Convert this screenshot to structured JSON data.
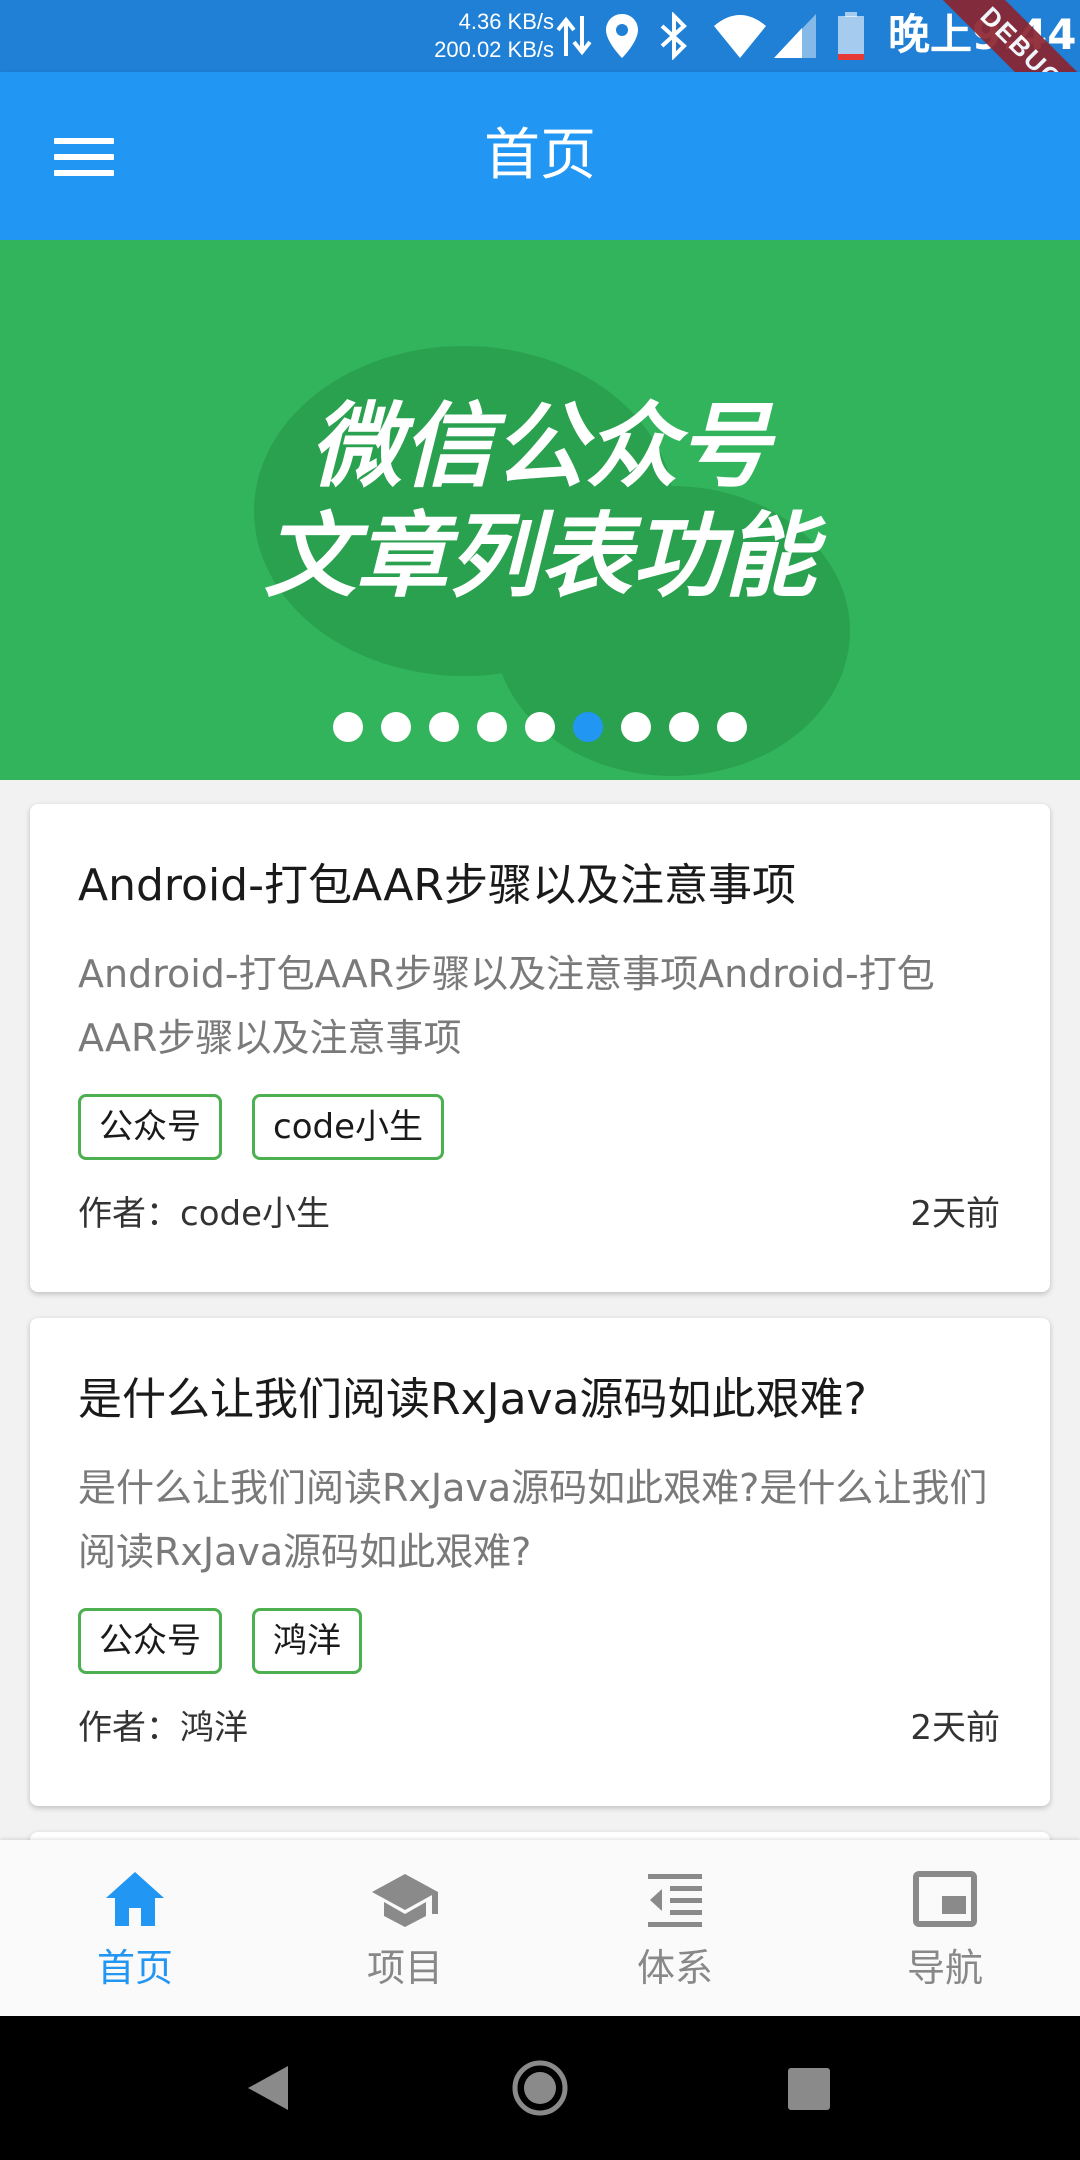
{
  "status_bar": {
    "net_up": "4.36 KB/s",
    "net_down": "200.02 KB/s",
    "time": "晚上9:44",
    "debug_label": "DEBUG",
    "icons": [
      "data-transfer-icon",
      "location-icon",
      "bluetooth-icon",
      "wifi-icon",
      "signal-icon",
      "battery-icon"
    ]
  },
  "app_bar": {
    "title": "首页",
    "menu_icon": "menu-icon",
    "color": "#2196f3"
  },
  "banner": {
    "line1": "微信公众号",
    "line2": "文章列表功能",
    "background": "#32b45c",
    "dot_count": 9,
    "active_dot_index": 5
  },
  "articles": [
    {
      "title": "Android-打包AAR步骤以及注意事项",
      "desc": "Android-打包AAR步骤以及注意事项Android-打包AAR步骤以及注意事项",
      "tags": [
        "公众号",
        "code小生"
      ],
      "author": "作者：code小生",
      "time": "2天前"
    },
    {
      "title": "是什么让我们阅读RxJava源码如此艰难?",
      "desc": "是什么让我们阅读RxJava源码如此艰难?是什么让我们阅读RxJava源码如此艰难?",
      "tags": [
        "公众号",
        "鸿洋"
      ],
      "author": "作者：鸿洋",
      "time": "2天前"
    }
  ],
  "bottom_nav": {
    "items": [
      {
        "label": "首页",
        "icon": "home-icon",
        "active": true
      },
      {
        "label": "项目",
        "icon": "school-icon",
        "active": false
      },
      {
        "label": "体系",
        "icon": "format-indent-icon",
        "active": false
      },
      {
        "label": "导航",
        "icon": "picture-in-picture-icon",
        "active": false
      }
    ],
    "active_color": "#2196f3",
    "inactive_color": "#888888"
  },
  "system_nav": {
    "icons": [
      "back-icon",
      "home-circle-icon",
      "recents-icon"
    ]
  }
}
